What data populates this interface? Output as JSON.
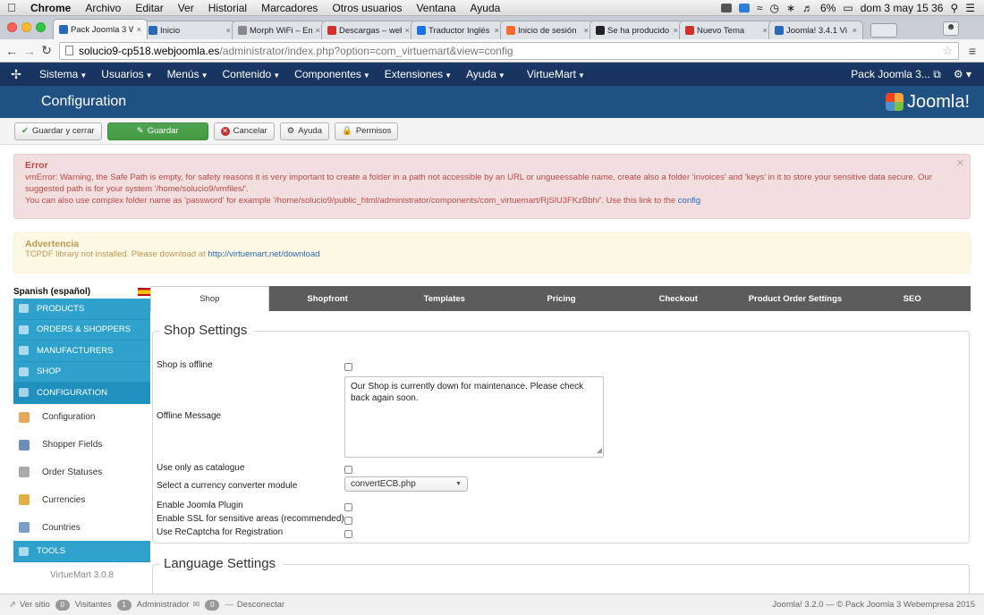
{
  "mac_menu": {
    "app": "Chrome",
    "items": [
      "Archivo",
      "Editar",
      "Ver",
      "Historial",
      "Marcadores",
      "Otros usuarios",
      "Ventana",
      "Ayuda"
    ],
    "battery": "6%",
    "clock": "dom 3 may  15 36"
  },
  "browser": {
    "tabs": [
      {
        "title": "Pack Joomla 3 W",
        "active": true,
        "color": "#2a69b8"
      },
      {
        "title": "Inicio",
        "active": false,
        "color": "#2a69b8"
      },
      {
        "title": "Morph WiFi – Em",
        "active": false,
        "color": "#888888"
      },
      {
        "title": "Descargas – web",
        "active": false,
        "color": "#d0312d"
      },
      {
        "title": "Traductor Inglés",
        "active": false,
        "color": "#1a73e8"
      },
      {
        "title": "Inicio de sesión",
        "active": false,
        "color": "#ff6c2c"
      },
      {
        "title": "Se ha producido",
        "active": false,
        "color": "#222222"
      },
      {
        "title": "Nuevo Tema",
        "active": false,
        "color": "#d0312d"
      },
      {
        "title": "Joomla! 3.4.1 Vi",
        "active": false,
        "color": "#2a69b8"
      }
    ],
    "url_host": "solucio9-cp518.webjoomla.es",
    "url_path": "/administrator/index.php?option=com_virtuemart&view=config"
  },
  "joomla_nav": {
    "items": [
      "Sistema",
      "Usuarios",
      "Menús",
      "Contenido",
      "Componentes",
      "Extensiones",
      "Ayuda"
    ],
    "virtuemart": "VirtueMart",
    "site_link": "Pack Joomla 3... ⧉"
  },
  "page": {
    "title": "Configuration",
    "brand": "Joomla!"
  },
  "toolbar": {
    "save_close": "Guardar y cerrar",
    "save": "Guardar",
    "cancel": "Cancelar",
    "help": "Ayuda",
    "permissions": "Permisos"
  },
  "error_alert": {
    "heading": "Error",
    "line1": "vmError: Warning, the Safe Path is empty, for safety reasons it is very important to create a folder in a path not accessible by an URL or ungueessable name, create also a folder 'invoices' and 'keys' in it to store your sensitive data secure. Our suggested path is for your system '/home/solucio9/vmfiles/'.",
    "line2": "You can also use complex folder name as 'password' for example '/home/solucio9/public_html/administrator/components/com_virtuemart/RjSlU3FKzBbh/'. Use this link to the",
    "link": "config"
  },
  "warning_alert": {
    "heading": "Advertencia",
    "text": "TCPDF library not installed. Please download at",
    "link": "http://virtuemart.net/download"
  },
  "sidebar": {
    "language": "Spanish (español)",
    "sections": [
      {
        "label": "PRODUCTS",
        "icon": "products-icon"
      },
      {
        "label": "ORDERS & SHOPPERS",
        "icon": "orders-icon"
      },
      {
        "label": "MANUFACTURERS",
        "icon": "manufacturers-icon"
      },
      {
        "label": "SHOP",
        "icon": "shop-icon"
      },
      {
        "label": "CONFIGURATION",
        "icon": "configuration-icon"
      }
    ],
    "sub_items": [
      {
        "label": "Configuration",
        "icon": "wrench-icon"
      },
      {
        "label": "Shopper Fields",
        "icon": "shopper-fields-icon"
      },
      {
        "label": "Order Statuses",
        "icon": "order-status-icon"
      },
      {
        "label": "Currencies",
        "icon": "currency-icon"
      },
      {
        "label": "Countries",
        "icon": "globe-icon"
      }
    ],
    "tools": "TOOLS",
    "version": "VirtueMart 3.0.8"
  },
  "tabs": [
    "Shop",
    "Shopfront",
    "Templates",
    "Pricing",
    "Checkout",
    "Product Order Settings",
    "SEO"
  ],
  "shop_settings": {
    "legend": "Shop Settings",
    "shop_offline": "Shop is offline",
    "offline_message_label": "Offline Message",
    "offline_message_value": "Our Shop is currently down for maintenance. Please check back again soon.",
    "catalogue": "Use only as catalogue",
    "currency_module_label": "Select a currency converter module",
    "currency_module_value": "convertECB.php",
    "joomla_plugin": "Enable Joomla Plugin",
    "ssl": "Enable SSL for sensitive areas (recommended)",
    "recaptcha": "Use ReCaptcha for Registration"
  },
  "language_settings": {
    "legend": "Language Settings"
  },
  "statusbar": {
    "view_site": "Ver sitio",
    "visitors_count": "0",
    "visitors": "Visitantes",
    "admins_count": "1",
    "admins": "Administrador",
    "messages_count": "0",
    "logout": "Desconectar",
    "footer": "Joomla! 3.2.0  —  © Pack Joomla 3 Webempresa 2015"
  }
}
